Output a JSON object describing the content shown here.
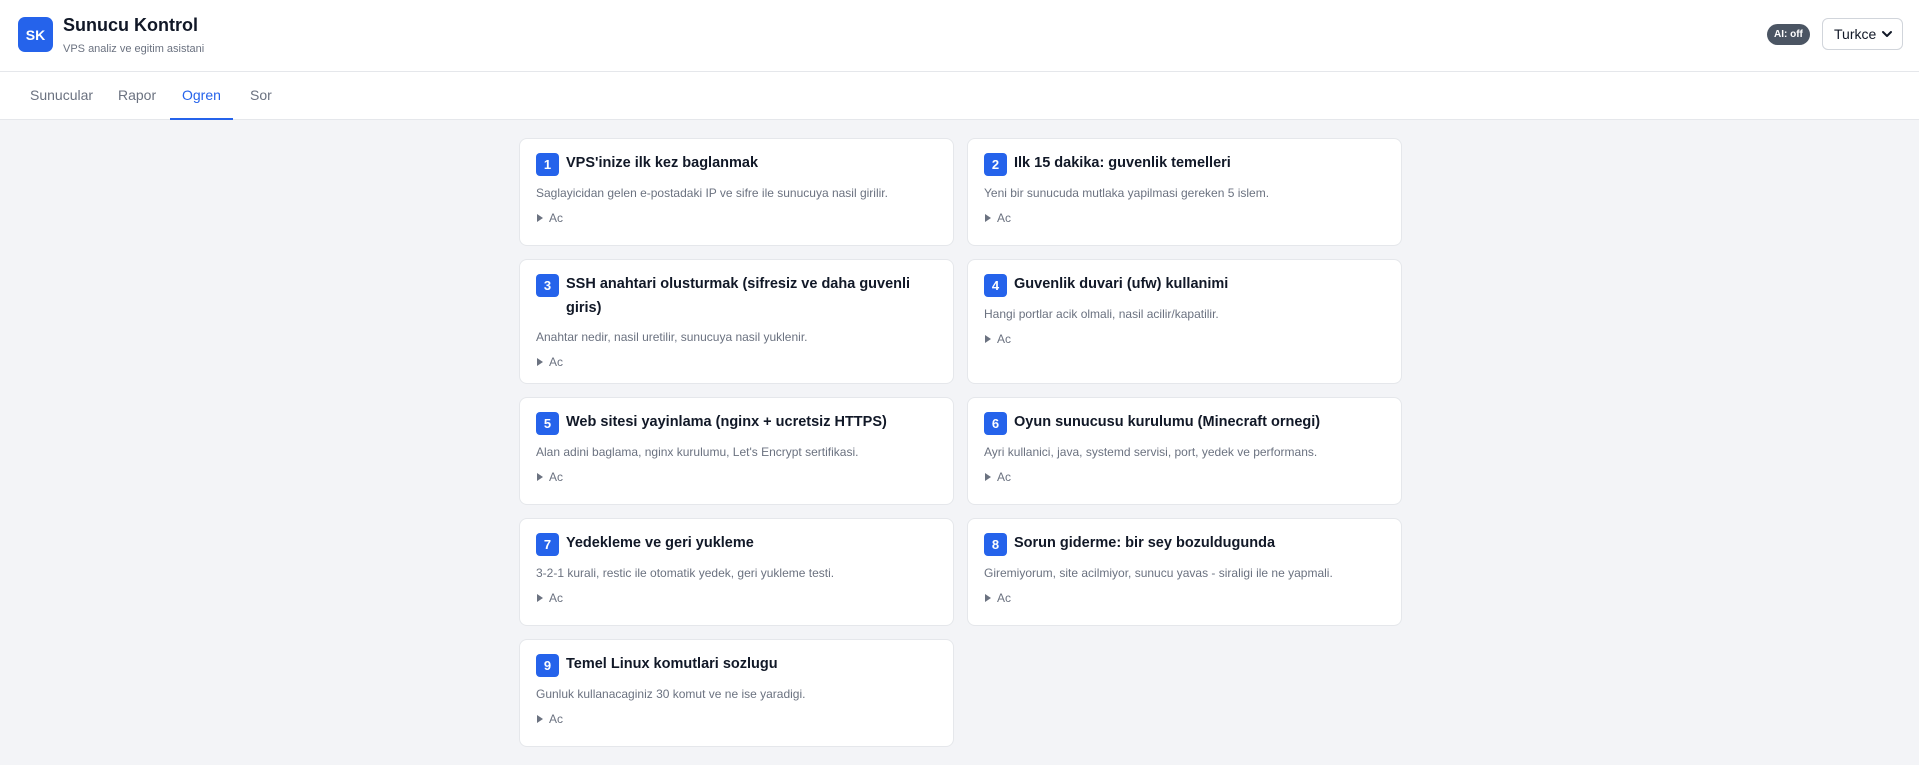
{
  "header": {
    "logo_text": "SK",
    "title": "Sunucu Kontrol",
    "subtitle": "VPS analiz ve egitim asistani",
    "ai_badge": "AI: off",
    "language": "Turkce"
  },
  "tabs": [
    {
      "label": "Sunucular"
    },
    {
      "label": "Rapor"
    },
    {
      "label": "Ogren"
    },
    {
      "label": "Sor"
    }
  ],
  "active_tab": "Ogren",
  "colors": {
    "accent": "#2563eb",
    "badge": "#4b5563"
  },
  "lessons": [
    {
      "num": "1",
      "title": "VPS'inize ilk kez baglanmak",
      "desc": "Saglayicidan gelen e-postadaki IP ve sifre ile sunucuya nasil girilir.",
      "toggle": "Ac"
    },
    {
      "num": "2",
      "title": "Ilk 15 dakika: guvenlik temelleri",
      "desc": "Yeni bir sunucuda mutlaka yapilmasi gereken 5 islem.",
      "toggle": "Ac"
    },
    {
      "num": "3",
      "title": "SSH anahtari olusturmak (sifresiz ve daha guvenli giris)",
      "desc": "Anahtar nedir, nasil uretilir, sunucuya nasil yuklenir.",
      "toggle": "Ac"
    },
    {
      "num": "4",
      "title": "Guvenlik duvari (ufw) kullanimi",
      "desc": "Hangi portlar acik olmali, nasil acilir/kapatilir.",
      "toggle": "Ac"
    },
    {
      "num": "5",
      "title": "Web sitesi yayinlama (nginx + ucretsiz HTTPS)",
      "desc": "Alan adini baglama, nginx kurulumu, Let's Encrypt sertifikasi.",
      "toggle": "Ac"
    },
    {
      "num": "6",
      "title": "Oyun sunucusu kurulumu (Minecraft ornegi)",
      "desc": "Ayri kullanici, java, systemd servisi, port, yedek ve performans.",
      "toggle": "Ac"
    },
    {
      "num": "7",
      "title": "Yedekleme ve geri yukleme",
      "desc": "3-2-1 kurali, restic ile otomatik yedek, geri yukleme testi.",
      "toggle": "Ac"
    },
    {
      "num": "8",
      "title": "Sorun giderme: bir sey bozuldugunda",
      "desc": "Giremiyorum, site acilmiyor, sunucu yavas - siraligi ile ne yapmali.",
      "toggle": "Ac"
    },
    {
      "num": "9",
      "title": "Temel Linux komutlari sozlugu",
      "desc": "Gunluk kullanacaginiz 30 komut ve ne ise yaradigi.",
      "toggle": "Ac"
    }
  ]
}
